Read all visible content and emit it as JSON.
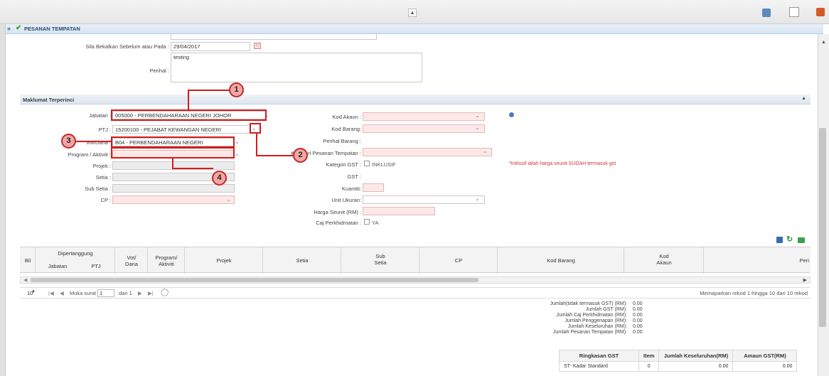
{
  "window": {
    "title": "PESANAN TEMPATAN"
  },
  "form_top": {
    "sila_label": "Sila Bekalkan Sebelum atau Pada :",
    "sila_value": "29/04/2017",
    "perihal_label": "Perihal :",
    "perihal_value": "testing"
  },
  "section": {
    "title": "Maklumat Terperinci"
  },
  "left_fields": {
    "jabatan_label": "Jabatan :",
    "jabatan_value": "005000 - PERBENDAHARAAN NEGERI JOHOR",
    "ptj_label": "PTJ :",
    "ptj_value": "15200100 - PEJABAT KEWANGAN NEGERI",
    "vot_label": "Vot/Dana :",
    "vot_value": "B04 - PERBENDAHARAAN NEGERI",
    "program_label": "Program / Aktiviti :",
    "projek_label": "Projek :",
    "setia_label": "Setia :",
    "subsetia_label": "Sub Setia :",
    "cp_label": "CP :"
  },
  "right_fields": {
    "kod_akaun_label": "Kod Akaun :",
    "kod_barang_label": "Kod Barang:",
    "perihal_barang_label": "Perihal Barang :",
    "kategori_label": "Kategori Pesanan Tempatan :",
    "kategori_gst_label": "Kategori GST :",
    "inklusif_label": "INKLUSIF",
    "gst_label": "GST :",
    "kuantiti_label": "Kuantiti:",
    "unit_label": "Unit Ukuran:",
    "harga_label": "Harga Seunit (RM) :",
    "caj_label": "Caj Perkhidmatan :",
    "ya_label": "YA",
    "note": "*Inklusif ialah harga seunit SUDAH termasuk gst"
  },
  "callouts": [
    "1",
    "2",
    "3",
    "4"
  ],
  "grid": {
    "bil": "Bil",
    "dipertanggung": "Dipertanggung",
    "jabatan": "Jabatan",
    "ptj": "PTJ",
    "vot": "Vot/\nDana",
    "program": "Program/\nAktiviti",
    "projek": "Projek",
    "setia": "Setia",
    "subsetia": "Sub\nSetia",
    "cp": "CP",
    "kod_barang": "Kod Barang",
    "kod_akaun": "Kod\nAkaun",
    "peri": "Peri"
  },
  "pager": {
    "page_size": "10",
    "muka_surat": "Muka surat",
    "page": "1",
    "dari": "dari 1",
    "info": "Memaparkan rekod 1 hingga 10 dari 10 rekod"
  },
  "summary": [
    {
      "label": "Jumlah(tidak termasuk GST) (RM):",
      "value": "0.00"
    },
    {
      "label": "Jumlah GST (RM):",
      "value": "0.00"
    },
    {
      "label": "Jumlah Caj Perkhidmatan (RM):",
      "value": "0.00"
    },
    {
      "label": "Jumlah Penggenapan (RM):",
      "value": "0.00"
    },
    {
      "label": "Jumlah Keseluruhan (RM):",
      "value": "0.00"
    },
    {
      "label": "Jumlah Pesanan Tempatan (RM):",
      "value": "0.00"
    }
  ],
  "gst_table": {
    "headers": [
      "Ringkasan GST",
      "Item",
      "Jumlah Keseluruhan(RM)",
      "Amaun GST(RM)"
    ],
    "row": [
      "ST- Kadar Standard",
      "0",
      "0.00",
      "0.00"
    ]
  },
  "colors": {
    "callout_border": "#c02a2a",
    "required_fill": "#fde8e8"
  }
}
